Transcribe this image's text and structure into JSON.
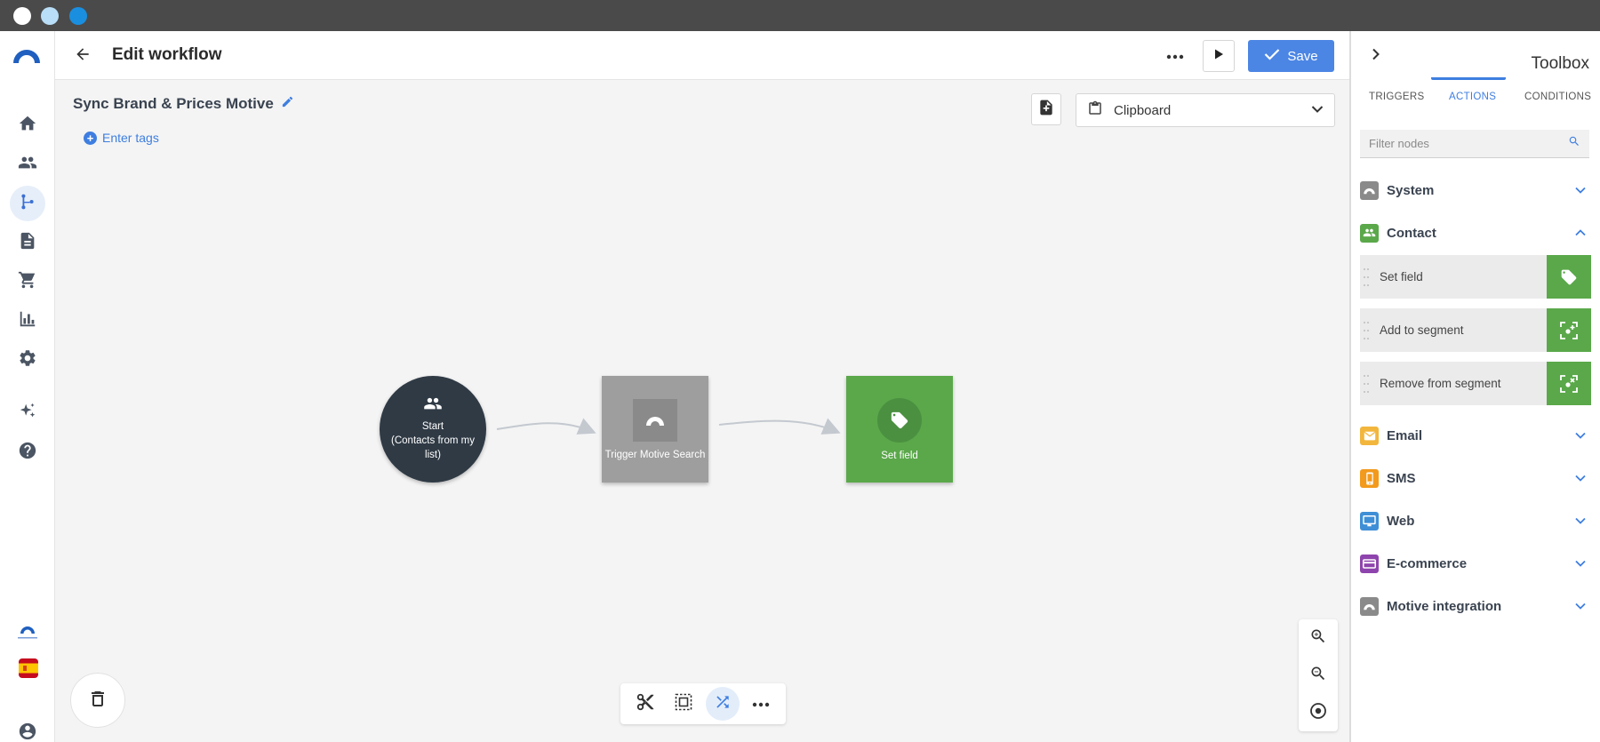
{
  "window": {
    "dots": [
      "#ffffff",
      "#b9def7",
      "#1a8fe0"
    ]
  },
  "leftnav": {
    "items": [
      {
        "name": "home-icon"
      },
      {
        "name": "contacts-icon"
      },
      {
        "name": "workflow-icon",
        "active": true
      },
      {
        "name": "document-icon"
      },
      {
        "name": "cart-icon"
      },
      {
        "name": "chart-icon"
      },
      {
        "name": "gear-icon"
      },
      {
        "name": "sparkle-icon"
      },
      {
        "name": "help-icon"
      },
      {
        "name": "user-icon"
      }
    ]
  },
  "header": {
    "title": "Edit workflow",
    "save_label": "Save",
    "accent": "#4c86e4"
  },
  "workflow": {
    "name": "Sync Brand & Prices Motive",
    "tags_label": "Enter tags",
    "clipboard_label": "Clipboard"
  },
  "nodes": {
    "start_line1": "Start",
    "start_line2": "(Contacts from my",
    "start_line3": "list)",
    "trigger_label": "Trigger Motive Search",
    "setfield_label": "Set field"
  },
  "toolbox": {
    "title": "Toolbox",
    "tabs": [
      "TRIGGERS",
      "ACTIONS",
      "CONDITIONS"
    ],
    "active_tab": "ACTIONS",
    "filter_placeholder": "Filter nodes",
    "categories": [
      {
        "label": "System",
        "color": "#8a8a8a",
        "expanded": false
      },
      {
        "label": "Contact",
        "color": "#5aa84a",
        "expanded": true
      },
      {
        "label": "Email",
        "color": "#f2b63d",
        "expanded": false
      },
      {
        "label": "SMS",
        "color": "#f29a1d",
        "expanded": false
      },
      {
        "label": "Web",
        "color": "#3e8fd6",
        "expanded": false
      },
      {
        "label": "E-commerce",
        "color": "#8e44ad",
        "expanded": false
      },
      {
        "label": "Motive integration",
        "color": "#8a8a8a",
        "expanded": false
      }
    ],
    "contact_items": [
      {
        "label": "Set field",
        "icon": "tag-icon"
      },
      {
        "label": "Add to segment",
        "icon": "segment-add-icon"
      },
      {
        "label": "Remove from segment",
        "icon": "segment-remove-icon"
      }
    ]
  }
}
